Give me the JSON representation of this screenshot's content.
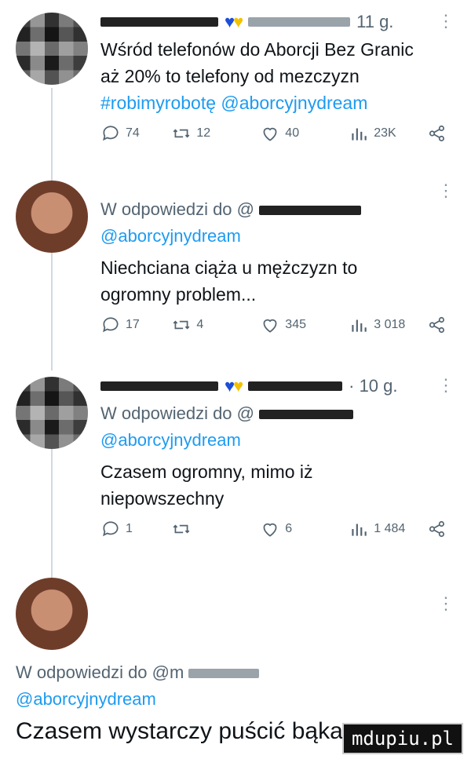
{
  "tweets": [
    {
      "time": "11 g.",
      "text_line1": "Wśród telefonów do Aborcji Bez Granic",
      "text_line2": "aż 20% to telefony od mezczyzn",
      "tags": "#robimyrobotę @aborcyjnydream",
      "replies": "74",
      "retweets": "12",
      "likes": "40",
      "views": "23K"
    },
    {
      "reply_prefix": "W odpowiedzi do @",
      "mention": "@aborcyjnydream",
      "text_line1": "Niechciana ciąża u mężczyzn to",
      "text_line2": "ogromny problem...",
      "replies": "17",
      "retweets": "4",
      "likes": "345",
      "views": "3 018"
    },
    {
      "time": "· 10 g.",
      "reply_prefix": "W odpowiedzi do @",
      "mention": "@aborcyjnydream",
      "text_line1": "Czasem ogromny, mimo iż",
      "text_line2": "niepowszechny",
      "replies": "1",
      "retweets": "",
      "likes": "6",
      "views": "1 484"
    },
    {
      "reply_prefix": "W odpowiedzi do @m",
      "mention": "@aborcyjnydream",
      "text_line1": "Czasem wystarczy puścić bąka..."
    }
  ],
  "watermark": "mdupiu.pl",
  "colors": {
    "link": "#1d9bf0",
    "muted": "#536471",
    "heart_blue": "#1d4ed8",
    "heart_yellow": "#f2c200"
  }
}
